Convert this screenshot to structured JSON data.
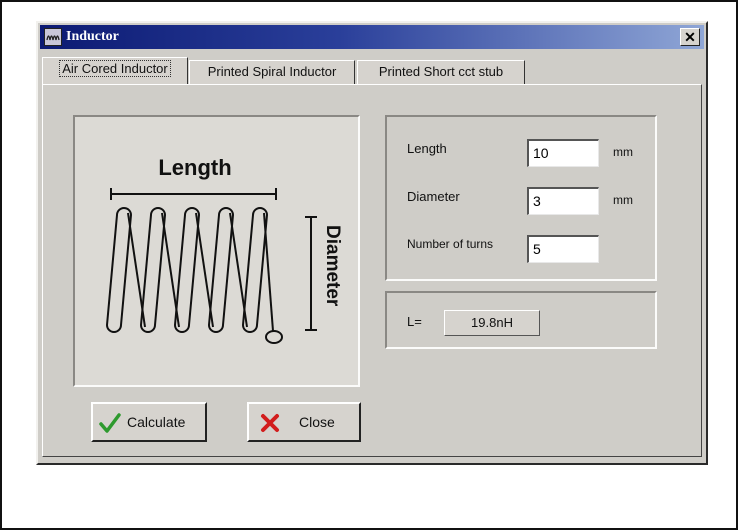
{
  "window": {
    "title": "Inductor",
    "close_symbol": "✕"
  },
  "tabs": [
    {
      "label": "Air Cored Inductor",
      "active": true
    },
    {
      "label": "Printed Spiral Inductor",
      "active": false
    },
    {
      "label": "Printed Short cct stub",
      "active": false
    }
  ],
  "diagram": {
    "length_label": "Length",
    "diameter_label": "Diameter"
  },
  "inputs": {
    "length": {
      "label": "Length",
      "value": "10",
      "unit": "mm"
    },
    "diameter": {
      "label": "Diameter",
      "value": "3",
      "unit": "mm"
    },
    "turns": {
      "label": "Number of turns",
      "value": "5"
    }
  },
  "result": {
    "label": "L=",
    "value": "19.8nH"
  },
  "buttons": {
    "calculate": "Calculate",
    "close": "Close"
  },
  "colors": {
    "titlebar_start": "#0c1a73",
    "titlebar_end": "#8fa6d6",
    "calculate_icon": "#2e9a2e",
    "close_icon": "#d21d1d"
  },
  "icons": {
    "app": "inductor-app-icon",
    "calculate": "checkmark-icon",
    "close": "x-icon",
    "window_close": "close-icon"
  }
}
